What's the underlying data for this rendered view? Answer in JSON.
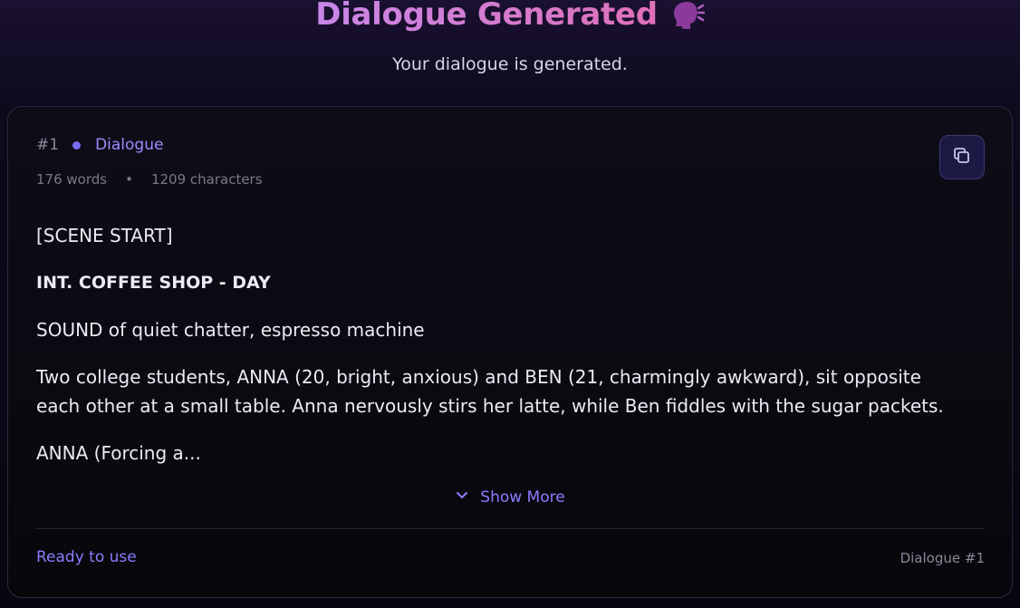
{
  "header": {
    "title": "Dialogue Generated",
    "title_icon": "speaking-head-icon",
    "subtitle": "Your dialogue is generated."
  },
  "card": {
    "number": "#1",
    "type_label": "Dialogue",
    "word_count": "176 words",
    "separator": "•",
    "char_count": "1209 characters",
    "copy_icon": "copy-icon",
    "content": {
      "line1": "[SCENE START]",
      "line2": "INT. COFFEE SHOP - DAY",
      "line3": "SOUND of quiet chatter, espresso machine",
      "line4": "Two college students, ANNA (20, bright, anxious) and BEN (21, charmingly awkward), sit opposite each other at a small table. Anna nervously stirs her latte, while Ben fiddles with the sugar packets.",
      "line5": "ANNA (Forcing a..."
    },
    "show_more": "Show More",
    "status": "Ready to use",
    "footer_label": "Dialogue #1"
  },
  "colors": {
    "accent": "#8b7dff",
    "title_gradient_start": "#c887e8",
    "title_gradient_end": "#e070b8"
  }
}
